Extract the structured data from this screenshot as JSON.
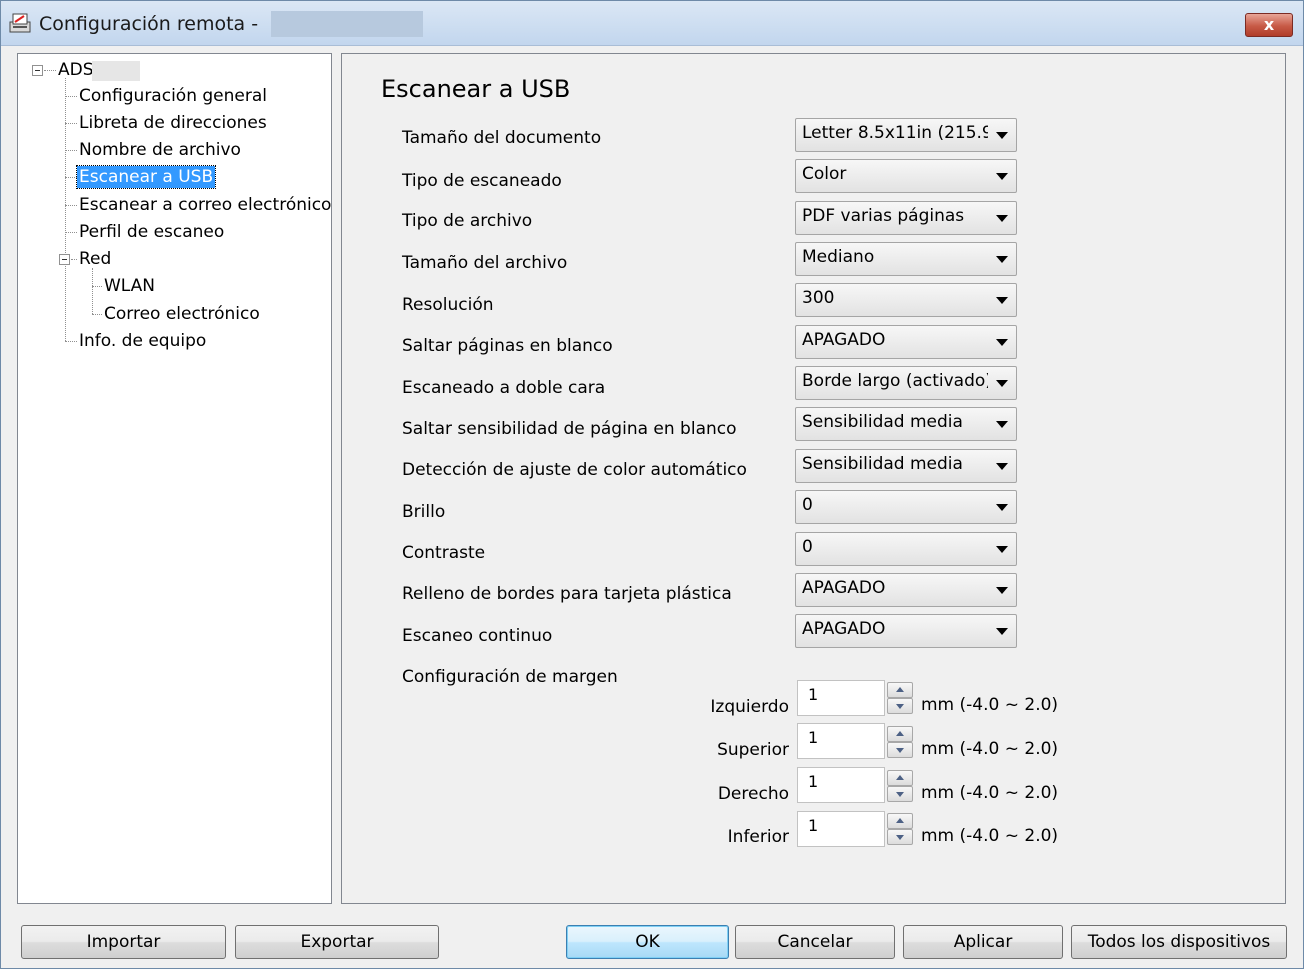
{
  "window": {
    "title": "Configuración remota -",
    "close_label": "x"
  },
  "tree": {
    "root_label": "ADS",
    "items": [
      {
        "label": "Configuración general"
      },
      {
        "label": "Libreta de direcciones"
      },
      {
        "label": "Nombre de archivo"
      },
      {
        "label": "Escanear a USB",
        "selected": true
      },
      {
        "label": "Escanear a correo electrónico"
      },
      {
        "label": "Perfil de escaneo"
      },
      {
        "label": "Red"
      },
      {
        "label": "WLAN"
      },
      {
        "label": "Correo electrónico"
      },
      {
        "label": "Info. de equipo"
      }
    ]
  },
  "content": {
    "title": "Escanear a USB",
    "settings": [
      {
        "label": "Tamaño del documento",
        "value": "Letter 8.5x11in (215.9"
      },
      {
        "label": "Tipo de escaneado",
        "value": "Color"
      },
      {
        "label": "Tipo de archivo",
        "value": "PDF varias páginas"
      },
      {
        "label": "Tamaño del archivo",
        "value": "Mediano"
      },
      {
        "label": "Resolución",
        "value": "300"
      },
      {
        "label": "Saltar páginas en blanco",
        "value": "APAGADO"
      },
      {
        "label": "Escaneado a doble cara",
        "value": "Borde largo (activado)"
      },
      {
        "label": "Saltar sensibilidad de página en blanco",
        "value": "Sensibilidad media"
      },
      {
        "label": "Detección de ajuste de color automático",
        "value": "Sensibilidad media"
      },
      {
        "label": "Brillo",
        "value": "0"
      },
      {
        "label": "Contraste",
        "value": "0"
      },
      {
        "label": "Relleno de bordes para tarjeta plástica",
        "value": "APAGADO"
      },
      {
        "label": "Escaneo continuo",
        "value": "APAGADO"
      }
    ],
    "margin": {
      "label": "Configuración de margen",
      "fields": [
        {
          "label": "Izquierdo",
          "value": "1",
          "range": "mm (-4.0 ~ 2.0)"
        },
        {
          "label": "Superior",
          "value": "1",
          "range": "mm (-4.0 ~ 2.0)"
        },
        {
          "label": "Derecho",
          "value": "1",
          "range": "mm (-4.0 ~ 2.0)"
        },
        {
          "label": "Inferior",
          "value": "1",
          "range": "mm (-4.0 ~ 2.0)"
        }
      ]
    }
  },
  "buttons": {
    "import": "Importar",
    "export": "Exportar",
    "ok": "OK",
    "cancel": "Cancelar",
    "apply": "Aplicar",
    "all_devices": "Todos los dispositivos"
  }
}
